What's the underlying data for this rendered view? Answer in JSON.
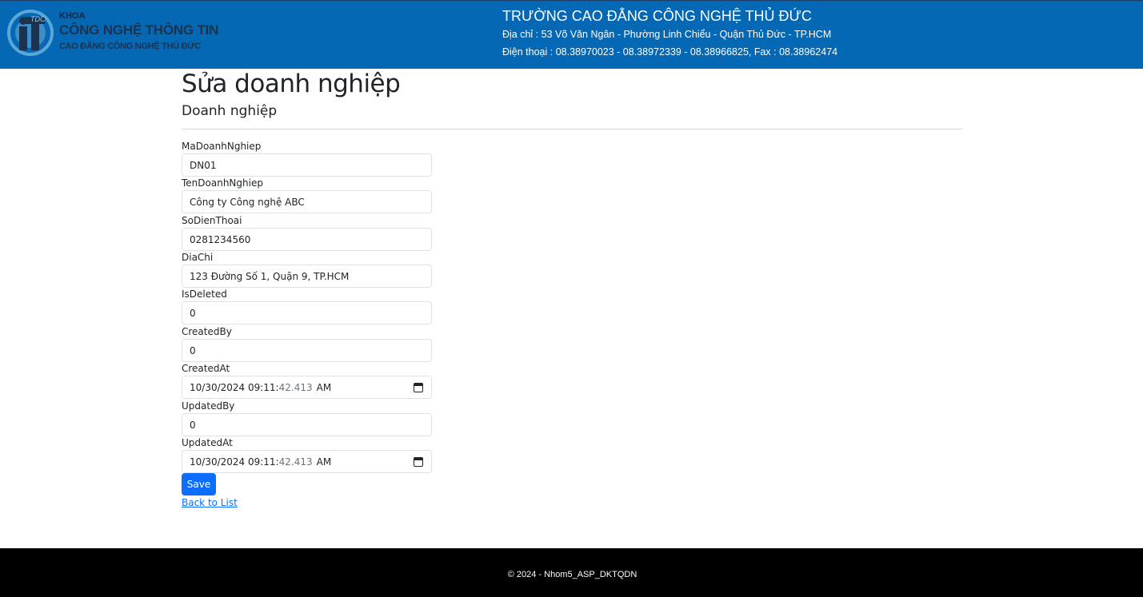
{
  "header": {
    "logo": {
      "badge": "TDC",
      "line1": "KHOA",
      "line2": "CÔNG NGHỆ THÔNG TIN",
      "line3": "CAO ĐẲNG CÔNG NGHỆ THỦ ĐỨC"
    },
    "school_name": "TRƯỜNG CAO ĐẲNG CÔNG NGHỆ THỦ ĐỨC",
    "address": "Địa chỉ : 53 Võ Văn Ngân - Phường Linh Chiểu - Quận Thủ Đức - TP.HCM",
    "phone": "Điện thoại : 08.38970023 - 08.38972339 - 08.38966825, Fax : 08.38962474",
    "colors": {
      "background": "#0468b4",
      "logo_text": "#1c3350"
    }
  },
  "page": {
    "title": "Sửa doanh nghiệp",
    "subtitle": "Doanh nghiệp"
  },
  "form": {
    "fields": [
      {
        "label": "MaDoanhNghiep",
        "value": "DN01"
      },
      {
        "label": "TenDoanhNghiep",
        "value": "Công ty Công nghệ ABC"
      },
      {
        "label": "SoDienThoai",
        "value": "0281234560"
      },
      {
        "label": "DiaChi",
        "value": "123 Đường Số 1, Quận 9, TP.HCM"
      },
      {
        "label": "IsDeleted",
        "value": "0"
      },
      {
        "label": "CreatedBy",
        "value": "0"
      },
      {
        "label": "CreatedAt",
        "value_main": "10/30/2024 09:11:",
        "value_sec": "42.413",
        "value_ampm": "AM",
        "icon": "calendar-icon"
      },
      {
        "label": "UpdatedBy",
        "value": "0"
      },
      {
        "label": "UpdatedAt",
        "value_main": "10/30/2024 09:11:",
        "value_sec": "42.413",
        "value_ampm": "AM",
        "icon": "calendar-icon"
      }
    ],
    "save_label": "Save",
    "back_label": "Back to List",
    "colors": {
      "primary": "#0d6efd"
    }
  },
  "footer": {
    "text": "© 2024 - Nhom5_ASP_DKTQDN",
    "colors": {
      "background": "#000000"
    }
  }
}
